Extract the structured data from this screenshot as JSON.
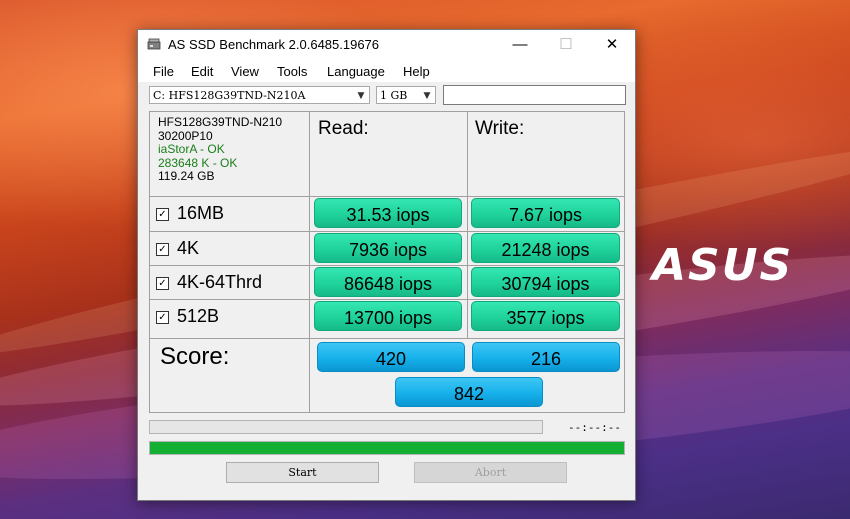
{
  "desktop": {
    "brand_text": "ASUS"
  },
  "window": {
    "title": "AS SSD Benchmark 2.0.6485.19676",
    "controls": {
      "minimize": "—",
      "maximize": "☐",
      "close": "✕"
    }
  },
  "menu": [
    "File",
    "Edit",
    "View",
    "Tools",
    "Language",
    "Help"
  ],
  "toolbar": {
    "drive_select": "C: HFS128G39TND-N210A",
    "size_select": "1 GB",
    "text_field": ""
  },
  "drive_info": {
    "model": "HFS128G39TND-N210",
    "firmware": "30200P10",
    "driver": "iaStorA - OK",
    "alignment": "283648 K - OK",
    "capacity": "119.24 GB"
  },
  "headers": {
    "read": "Read:",
    "write": "Write:"
  },
  "tests": [
    {
      "label": "16MB",
      "checked": true,
      "read": "31.53 iops",
      "write": "7.67 iops"
    },
    {
      "label": "4K",
      "checked": true,
      "read": "7936 iops",
      "write": "21248 iops"
    },
    {
      "label": "4K-64Thrd",
      "checked": true,
      "read": "86648 iops",
      "write": "30794 iops"
    },
    {
      "label": "512B",
      "checked": true,
      "read": "13700 iops",
      "write": "3577 iops"
    }
  ],
  "score": {
    "label": "Score:",
    "read": "420",
    "write": "216",
    "total": "842"
  },
  "progress": {
    "time_text": "--:--:--",
    "main_fraction": 1.0
  },
  "buttons": {
    "start": "Start",
    "abort": "Abort"
  },
  "colors": {
    "result_green": "#1fd39b",
    "score_blue": "#16b1eb",
    "progress_green": "#14b034"
  }
}
